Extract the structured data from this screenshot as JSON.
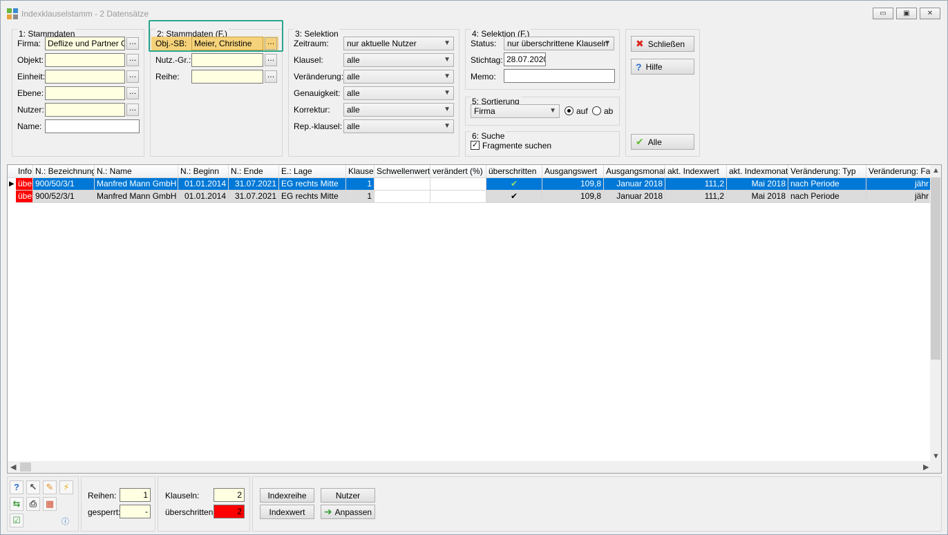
{
  "window": {
    "title": "Indexklauselstamm - 2 Datensätze",
    "minimize": "▭",
    "maximize": "▣",
    "close": "✕"
  },
  "stammdaten1": {
    "title": "1: Stammdaten",
    "firma_label": "Firma:",
    "firma_value": "Deflize und Partner Gml",
    "objekt_label": "Objekt:",
    "einheit_label": "Einheit:",
    "ebene_label": "Ebene:",
    "nutzer_label": "Nutzer:",
    "name_label": "Name:"
  },
  "stammdaten2": {
    "title": "2: Stammdaten (F.)",
    "objsb_label": "Obj.-SB:",
    "objsb_value": "Meier, Christine",
    "nutzgr_label": "Nutz.-Gr.:",
    "reihe_label": "Reihe:"
  },
  "selektion3": {
    "title": "3: Selektion",
    "rows": [
      {
        "label": "Zeitraum:",
        "value": "nur aktuelle Nutzer"
      },
      {
        "label": "Klausel:",
        "value": "alle"
      },
      {
        "label": "Veränderung:",
        "value": "alle"
      },
      {
        "label": "Genauigkeit:",
        "value": "alle"
      },
      {
        "label": "Korrektur:",
        "value": "alle"
      },
      {
        "label": "Rep.-klausel:",
        "value": "alle"
      }
    ]
  },
  "selektion4": {
    "title": "4: Selektion (F.)",
    "status_label": "Status:",
    "status_value": "nur überschrittene Klauseln",
    "stichtag_label": "Stichtag:",
    "stichtag_value": "28.07.2020",
    "memo_label": "Memo:"
  },
  "sortierung": {
    "title": "5: Sortierung",
    "value": "Firma",
    "auf": "auf",
    "ab": "ab"
  },
  "suche": {
    "title": "6: Suche",
    "fragmente": "Fragmente suchen"
  },
  "actions": {
    "schliessen": "Schließen",
    "hilfe": "Hilfe",
    "alle": "Alle"
  },
  "grid": {
    "headers": [
      "Info",
      "N.: Bezeichnung",
      "N.: Name",
      "N.: Beginn",
      "N.: Ende",
      "E.: Lage",
      "Klausel",
      "Schwellenwert",
      "verändert (%)",
      "überschritten",
      "Ausgangswert",
      "Ausgangsmonat",
      "akt. Indexwert",
      "akt. Indexmonat",
      "Veränderung: Typ",
      "Veränderung: Fakt"
    ],
    "rows": [
      [
        "über",
        "900/50/3/1",
        "Manfred Mann GmbH",
        "01.01.2014",
        "31.07.2021",
        "EG rechts Mitte",
        "1",
        "",
        "",
        "✔",
        "109,8",
        "Januar 2018",
        "111,2",
        "Mai 2018",
        "nach Periode",
        "jähr"
      ],
      [
        "über",
        "900/52/3/1",
        "Manfred Mann GmbH",
        "01.01.2014",
        "31.07.2021",
        "EG rechts Mitte",
        "1",
        "",
        "",
        "✔",
        "109,8",
        "Januar 2018",
        "111,2",
        "Mai 2018",
        "nach Periode",
        "jähr"
      ]
    ]
  },
  "bottom": {
    "reihen_label": "Reihen:",
    "reihen_value": "1",
    "gesperrt_label": "gesperrt:",
    "gesperrt_value": "-",
    "klauseln_label": "Klauseln:",
    "klauseln_value": "2",
    "ueberschritten_label": "überschritten:",
    "ueberschritten_value": "2",
    "indexreihe": "Indexreihe",
    "nutzer": "Nutzer",
    "indexwert": "Indexwert",
    "anpassen": "Anpassen"
  },
  "colors": {
    "selection": "#0078d7",
    "alert": "#ff0000",
    "highlight_border": "#2aa58d",
    "highlight_fill": "#f5d27a",
    "input_yellow": "#ffffe1"
  }
}
